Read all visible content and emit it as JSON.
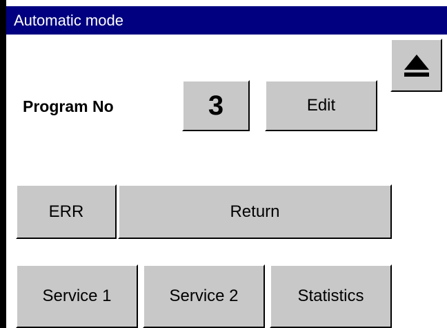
{
  "window": {
    "title": "Automatic mode"
  },
  "program": {
    "label": "Program No",
    "number": "3",
    "edit_label": "Edit"
  },
  "actions": {
    "err_label": "ERR",
    "return_label": "Return"
  },
  "bottom_buttons": {
    "service1_label": "Service 1",
    "service2_label": "Service 2",
    "statistics_label": "Statistics"
  },
  "icons": {
    "eject": "eject-icon"
  },
  "colors": {
    "titlebar": "#000080",
    "button_face": "#c8c8c8",
    "background": "#ffffff"
  }
}
